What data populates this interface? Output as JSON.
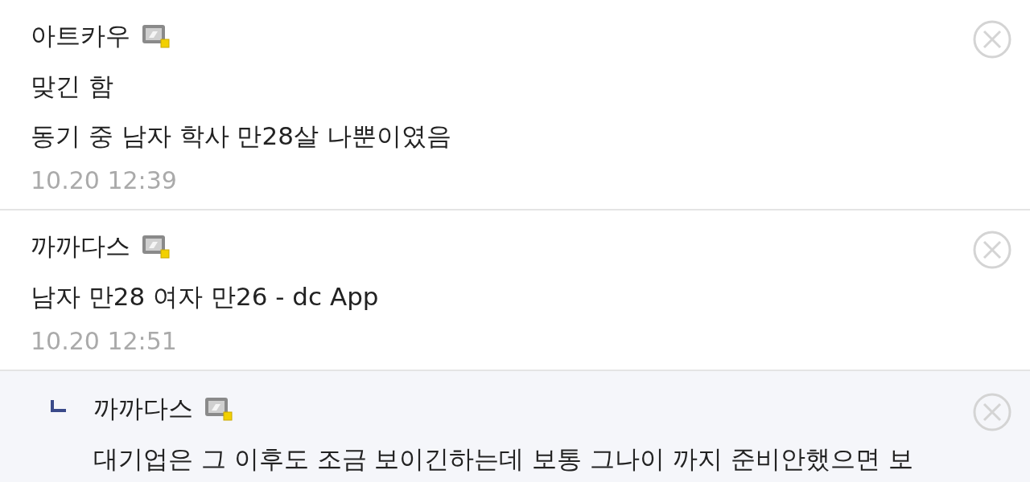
{
  "comments": [
    {
      "kind": "comment",
      "author": "아트카우",
      "lines": [
        "맞긴 함",
        "동기 중 남자 학사 만28살 나뿐이였음"
      ],
      "date": "10.20 12:39"
    },
    {
      "kind": "comment",
      "author": "까까다스",
      "lines": [
        "남자 만28 여자 만26 - dc App"
      ],
      "date": "10.20 12:51"
    },
    {
      "kind": "reply",
      "author": "까까다스",
      "lines": [
        "대기업은 그 이후도 조금 보이긴하는데 보통 그나이 까지 준비안했으면 보"
      ]
    }
  ]
}
